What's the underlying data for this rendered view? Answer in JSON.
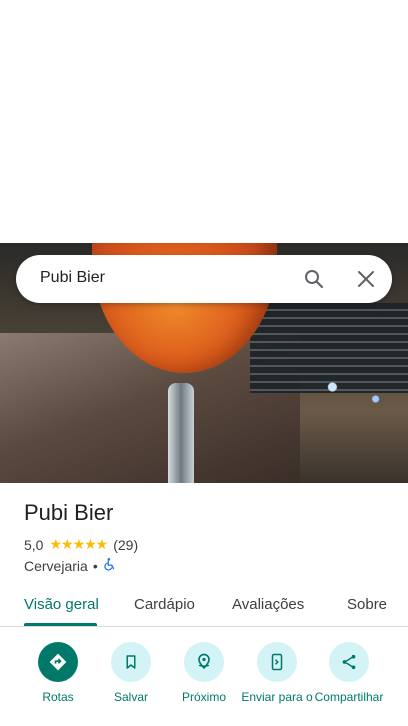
{
  "search": {
    "query": "Pubi Bier"
  },
  "place": {
    "title": "Pubi Bier",
    "rating": "5,0",
    "stars": "★★★★★",
    "review_count": "(29)",
    "category": "Cervejaria",
    "separator": "•",
    "accessibility_icon": "wheelchair-icon"
  },
  "tabs": [
    {
      "label": "Visão geral",
      "active": true
    },
    {
      "label": "Cardápio"
    },
    {
      "label": "Avaliações"
    },
    {
      "label": "Sobre"
    }
  ],
  "actions": [
    {
      "label": "Rotas",
      "icon": "directions-icon"
    },
    {
      "label": "Salvar",
      "icon": "bookmark-icon"
    },
    {
      "label": "Próximo",
      "icon": "nearby-icon"
    },
    {
      "label": "Enviar para o",
      "icon": "send-to-phone-icon"
    },
    {
      "label": "Compartilhar",
      "icon": "share-icon"
    }
  ],
  "colors": {
    "accent": "#00796b",
    "action_bg": "#d3f3f7",
    "star": "#fbbc04"
  }
}
